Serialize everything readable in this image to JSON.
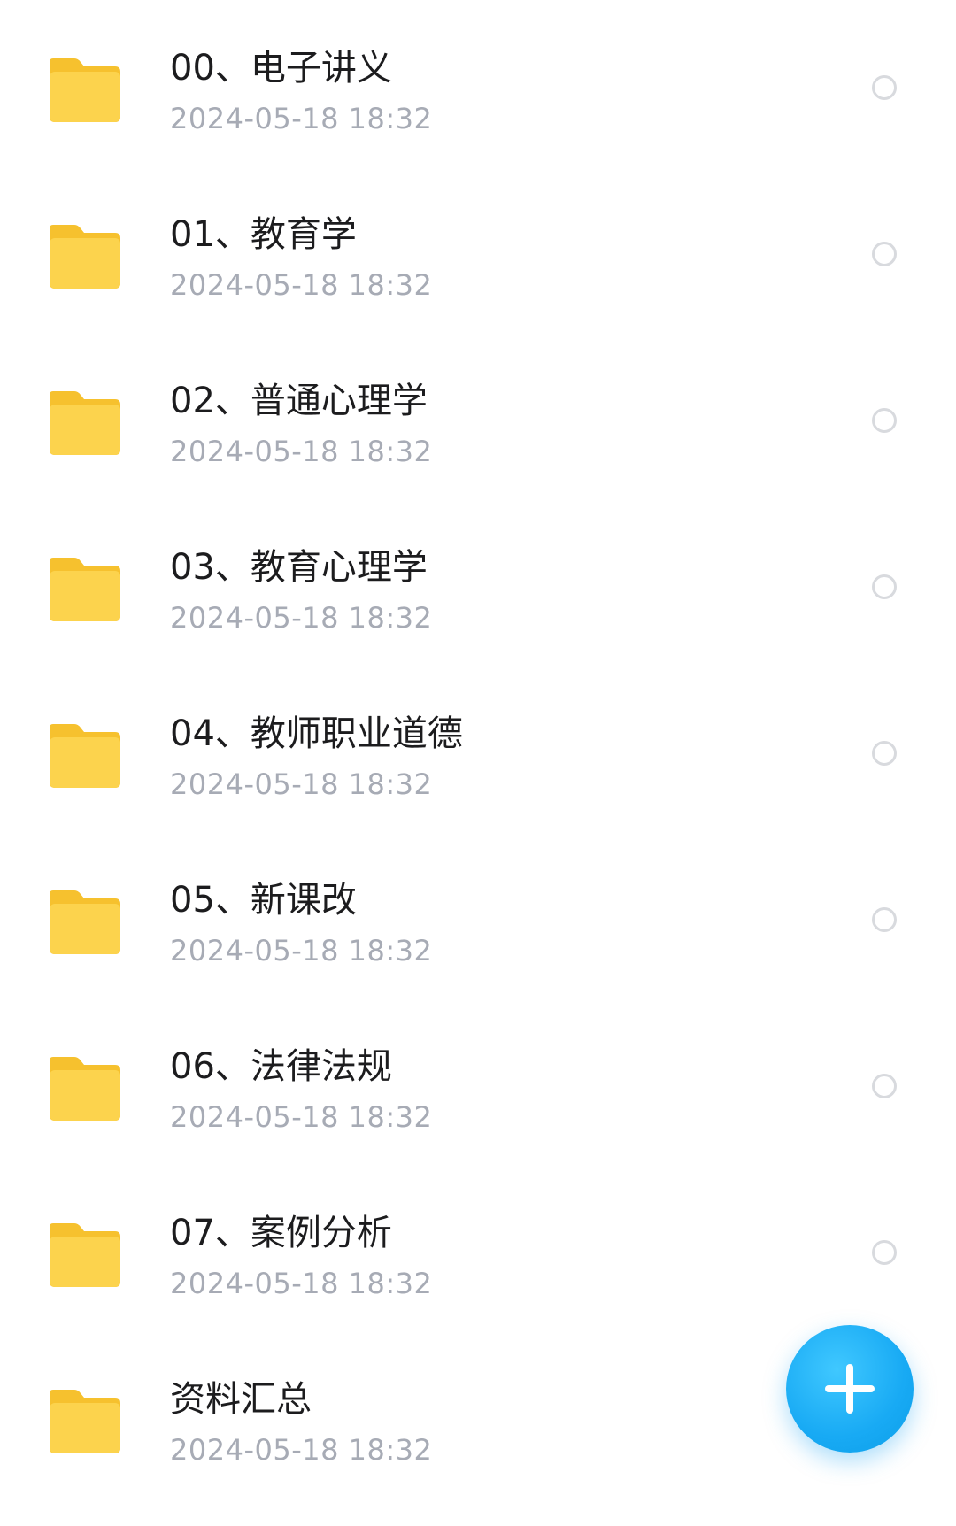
{
  "colors": {
    "folder": "#FCD34D",
    "folder_tab": "#F6C12E",
    "fab": "#1AAEF5",
    "name_text": "#1C1C1E",
    "date_text": "#A7ABB5"
  },
  "files": [
    {
      "name": "00、电子讲义",
      "date": "2024-05-18 18:32",
      "icon": "folder-icon"
    },
    {
      "name": "01、教育学",
      "date": "2024-05-18 18:32",
      "icon": "folder-icon"
    },
    {
      "name": "02、普通心理学",
      "date": "2024-05-18 18:32",
      "icon": "folder-icon"
    },
    {
      "name": "03、教育心理学",
      "date": "2024-05-18 18:32",
      "icon": "folder-icon"
    },
    {
      "name": "04、教师职业道德",
      "date": "2024-05-18 18:32",
      "icon": "folder-icon"
    },
    {
      "name": "05、新课改",
      "date": "2024-05-18 18:32",
      "icon": "folder-icon"
    },
    {
      "name": "06、法律法规",
      "date": "2024-05-18 18:32",
      "icon": "folder-icon"
    },
    {
      "name": "07、案例分析",
      "date": "2024-05-18 18:32",
      "icon": "folder-icon"
    },
    {
      "name": "资料汇总",
      "date": "2024-05-18 18:32",
      "icon": "folder-icon"
    }
  ],
  "fab": {
    "icon": "plus-icon"
  }
}
